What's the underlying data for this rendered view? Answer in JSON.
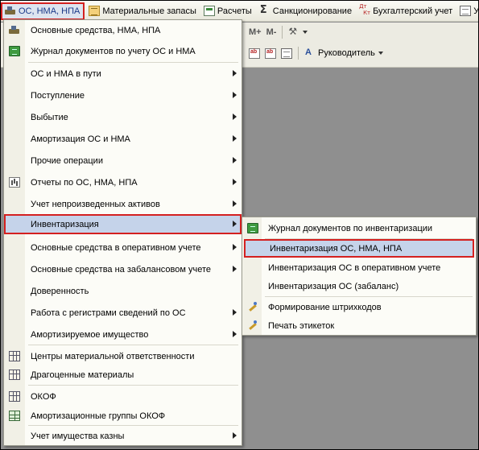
{
  "menubar": {
    "items": [
      {
        "label": "ОС, НМА, НПА",
        "icon": "truck-icon"
      },
      {
        "label": "Материальные запасы",
        "icon": "materials-icon"
      },
      {
        "label": "Расчеты",
        "icon": "calculations-icon"
      },
      {
        "label": "Санкционирование",
        "icon": "sum-icon"
      },
      {
        "label": "Бухгалтерский учет",
        "icon": "debit-credit-icon"
      },
      {
        "label": "Уч",
        "icon": "document-icon"
      }
    ]
  },
  "toolbar": {
    "mplus": "M+",
    "mminus": "M-",
    "manager_label": "Руководитель"
  },
  "main_menu": {
    "items": [
      {
        "label": "Основные средства, НМА, НПА",
        "icon": "truck-icon",
        "submenu": false
      },
      {
        "label": "Журнал документов по учету ОС и НМА",
        "icon": "journal-icon",
        "submenu": false
      },
      {
        "label": "ОС и НМА в пути",
        "icon": "",
        "submenu": true
      },
      {
        "label": "Поступление",
        "icon": "",
        "submenu": true
      },
      {
        "label": "Выбытие",
        "icon": "",
        "submenu": true
      },
      {
        "label": "Амортизация ОС и НМА",
        "icon": "",
        "submenu": true
      },
      {
        "label": "Прочие операции",
        "icon": "",
        "submenu": true
      },
      {
        "label": "Отчеты по ОС, НМА, НПА",
        "icon": "report-icon",
        "submenu": true
      },
      {
        "label": "Учет непроизведенных активов",
        "icon": "",
        "submenu": true
      },
      {
        "label": "Инвентаризация",
        "icon": "",
        "submenu": true,
        "highlighted": true
      },
      {
        "label": "Основные средства в оперативном учете",
        "icon": "",
        "submenu": true
      },
      {
        "label": "Основные средства на забалансовом учете",
        "icon": "",
        "submenu": true
      },
      {
        "label": "Доверенность",
        "icon": "",
        "submenu": false
      },
      {
        "label": "Работа с регистрами сведений по ОС",
        "icon": "",
        "submenu": true
      },
      {
        "label": "Амортизируемое имущество",
        "icon": "",
        "submenu": true
      },
      {
        "label": "Центры материальной ответственности",
        "icon": "table-icon",
        "submenu": false
      },
      {
        "label": "Драгоценные материалы",
        "icon": "table-icon",
        "submenu": false
      },
      {
        "label": "ОКОФ",
        "icon": "table-icon",
        "submenu": false
      },
      {
        "label": "Амортизационные группы ОКОФ",
        "icon": "grid-icon",
        "submenu": false
      },
      {
        "label": "Учет имущества казны",
        "icon": "",
        "submenu": true
      }
    ]
  },
  "sub_menu": {
    "items": [
      {
        "label": "Журнал документов по инвентаризации",
        "icon": "journal-icon"
      },
      {
        "label": "Инвентаризация ОС, НМА, НПА",
        "icon": "",
        "highlighted": true
      },
      {
        "label": "Инвентаризация ОС в оперативном учете",
        "icon": ""
      },
      {
        "label": "Инвентаризация ОС (забаланс)",
        "icon": ""
      },
      {
        "label": "Формирование штрихкодов",
        "icon": "wand-icon"
      },
      {
        "label": "Печать этикеток",
        "icon": "wand-icon"
      }
    ]
  },
  "colors": {
    "highlight_border": "#d42020",
    "highlight_fill": "#c5d3ea",
    "workspace": "#8f8f8f"
  }
}
